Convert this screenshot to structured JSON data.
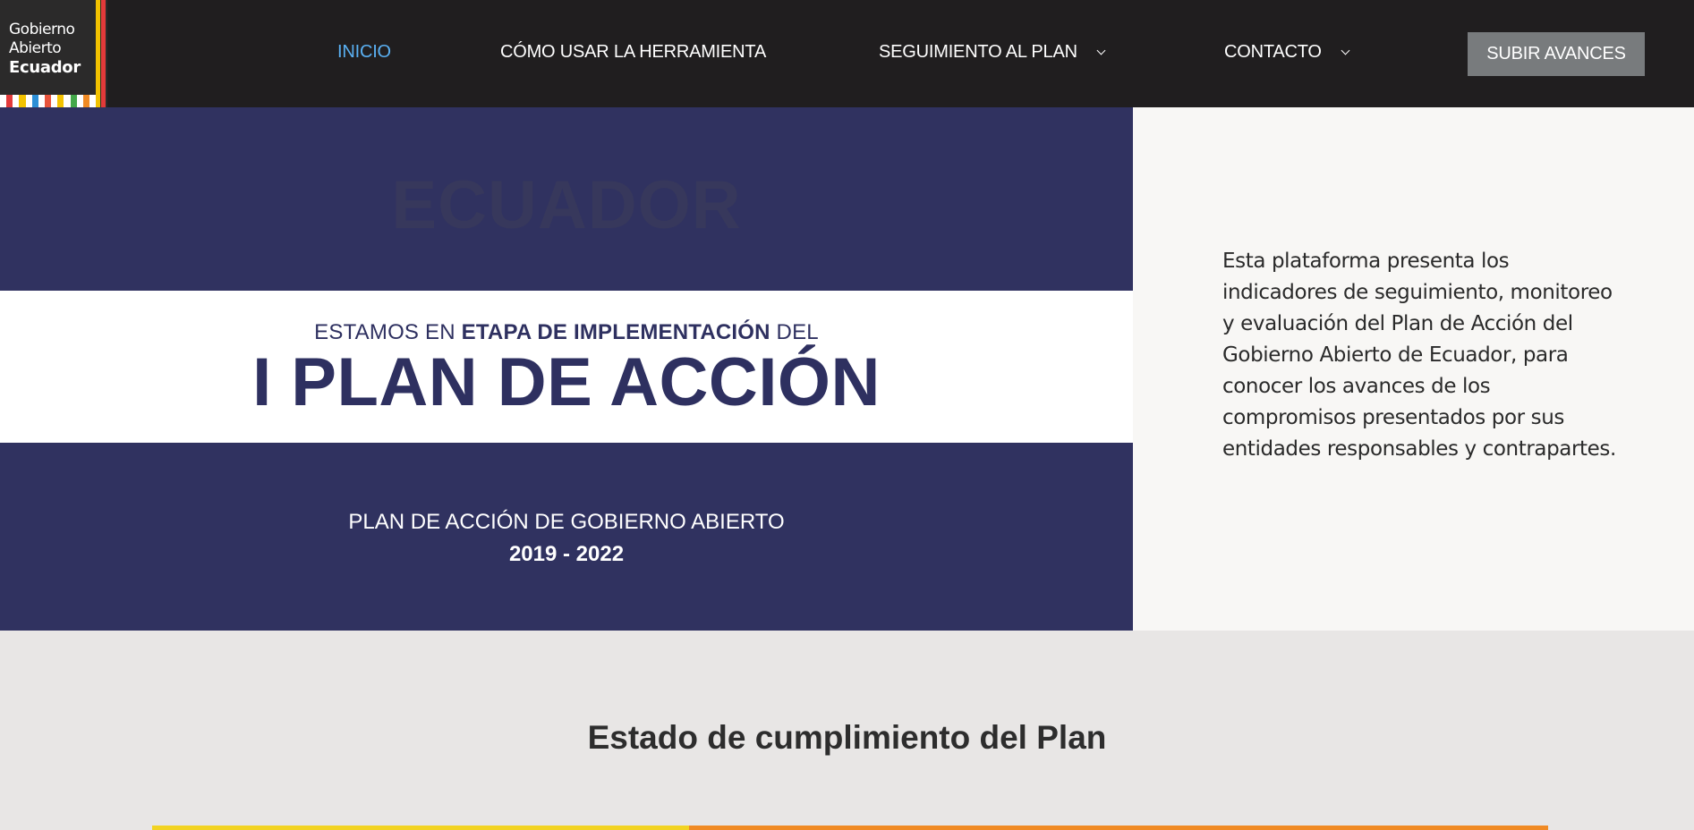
{
  "logo": {
    "line1": "Gobierno",
    "line2": "Abierto",
    "line3": "Ecuador",
    "stripe_colors": [
      "#ffffff",
      "#e23a3a",
      "#ffffff",
      "#f2c200",
      "#ffffff",
      "#2c8fd6",
      "#ffffff",
      "#e8543c",
      "#ffffff",
      "#f2c200",
      "#ffffff",
      "#44a84a",
      "#ffffff",
      "#f08a24",
      "#ffffff"
    ],
    "bar_colors": [
      "#f2c200",
      "#e23a3a"
    ]
  },
  "nav": {
    "items": [
      {
        "label": "INICIO",
        "active": true
      },
      {
        "label": "CÓMO USAR LA HERRAMIENTA",
        "active": false
      },
      {
        "label": "SEGUIMIENTO AL PLAN",
        "active": false,
        "dropdown": true
      },
      {
        "label": "CONTACTO",
        "active": false,
        "dropdown": true
      }
    ],
    "upload_button": "SUBIR AVANCES"
  },
  "hero": {
    "watermark": "ECUADOR",
    "stage_prefix": "ESTAMOS EN ",
    "stage_bold": "ETAPA DE IMPLEMENTACIÓN",
    "stage_suffix": " DEL",
    "title": "I PLAN DE ACCIÓN",
    "subtitle": "PLAN DE ACCIÓN DE GOBIERNO ABIERTO",
    "years": "2019 - 2022",
    "description": "Esta plataforma presenta los indicadores de seguimiento, monitoreo y evaluación del Plan de Acción del Gobierno Abierto de Ecuador, para conocer los avances de los compromisos presentados por sus entidades responsables y contrapartes."
  },
  "section": {
    "title": "Estado de cumplimiento del Plan"
  },
  "colors": {
    "nav_bg": "#201e1f",
    "nav_active": "#5ab0f2",
    "hero_navy": "#303260",
    "progress_yellow": "#f2d322",
    "progress_orange": "#f08a24"
  }
}
